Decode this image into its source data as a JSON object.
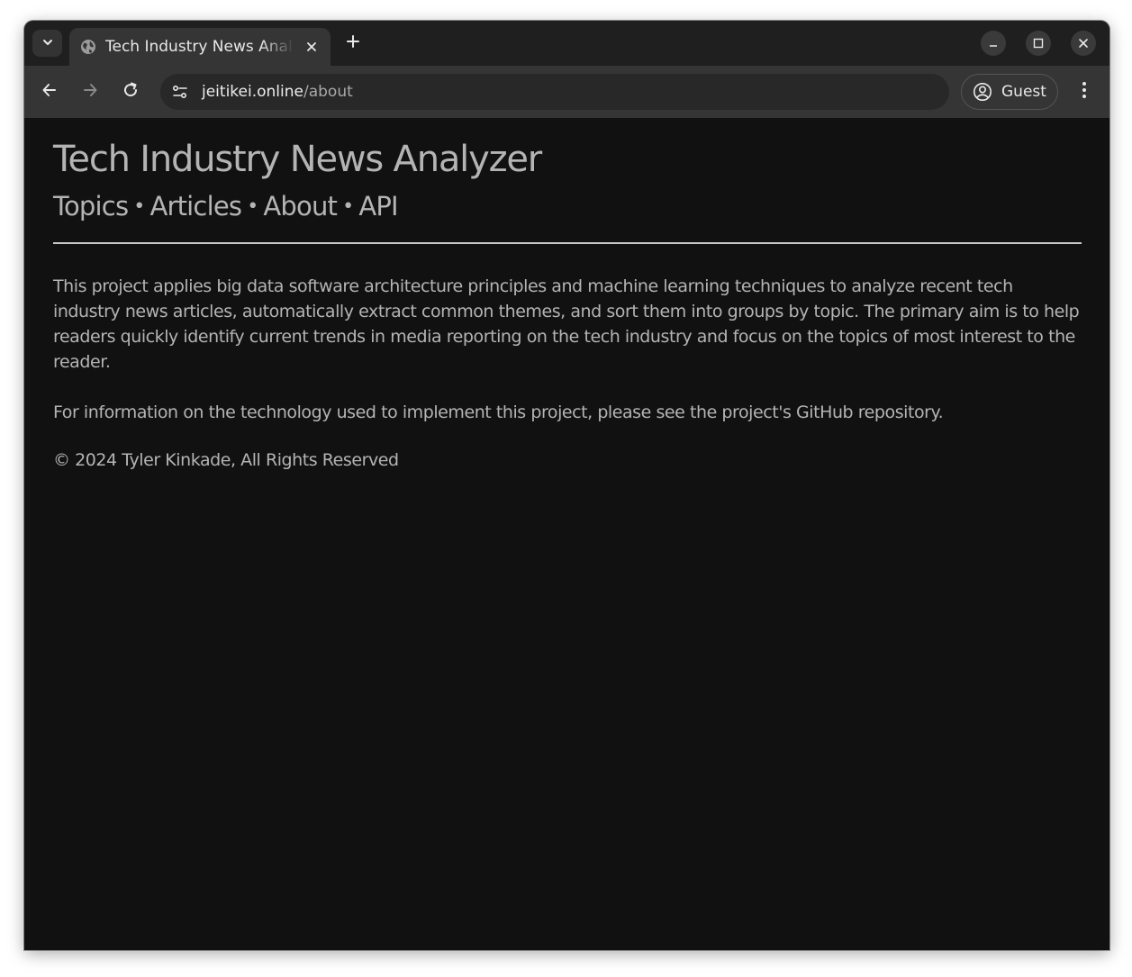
{
  "browser": {
    "tab": {
      "title": "Tech Industry News Analyzer",
      "close_icon": "close-icon",
      "favicon_icon": "globe-icon"
    },
    "new_tab_icon": "plus-icon",
    "url": {
      "host": "jeitikei.online",
      "path": "/about"
    },
    "profile_label": "Guest"
  },
  "page": {
    "title": "Tech Industry News Analyzer",
    "nav": [
      {
        "label": "Topics"
      },
      {
        "label": "Articles"
      },
      {
        "label": "About"
      },
      {
        "label": "API"
      }
    ],
    "nav_separator": "•",
    "paragraphs": [
      "This project applies big data software architecture principles and machine learning techniques to analyze recent tech industry news articles, automatically extract common themes, and sort them into groups by topic. The primary aim is to help readers quickly identify current trends in media reporting on the tech industry and focus on the topics of most interest to the reader.",
      "For information on the technology used to implement this project, please see the project's GitHub repository."
    ],
    "copyright": "© 2024 Tyler Kinkade, All Rights Reserved"
  },
  "colors": {
    "page_background": "#111111",
    "page_text": "#b4b4b4",
    "tabstrip": "#1f1f1f",
    "toolbar": "#353535",
    "omnibox": "#282828"
  }
}
